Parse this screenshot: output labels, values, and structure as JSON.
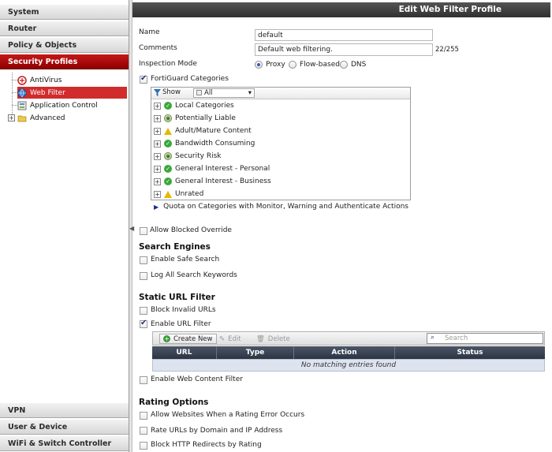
{
  "sidebar": {
    "sections_top": [
      "System",
      "Router",
      "Policy & Objects",
      "Security Profiles"
    ],
    "security_items": [
      "AntiVirus",
      "Web Filter",
      "Application Control",
      "Advanced"
    ],
    "sections_bottom": [
      "VPN",
      "User & Device",
      "WiFi & Switch Controller"
    ]
  },
  "page": {
    "title": "Edit Web Filter Profile",
    "name_label": "Name",
    "name_value": "default",
    "comments_label": "Comments",
    "comments_value": "Default web filtering.",
    "comments_count": "22/255",
    "inspection_label": "Inspection Mode",
    "inspection_options": [
      "Proxy",
      "Flow-based",
      "DNS"
    ],
    "fortiguard_label": "FortiGuard Categories"
  },
  "categories": {
    "show_label": "Show",
    "show_value": "All",
    "items": [
      {
        "label": "Local Categories",
        "status": "allow"
      },
      {
        "label": "Potentially Liable",
        "status": "monitor"
      },
      {
        "label": "Adult/Mature Content",
        "status": "warning"
      },
      {
        "label": "Bandwidth Consuming",
        "status": "allow"
      },
      {
        "label": "Security Risk",
        "status": "monitor"
      },
      {
        "label": "General Interest - Personal",
        "status": "allow"
      },
      {
        "label": "General Interest - Business",
        "status": "allow"
      },
      {
        "label": "Unrated",
        "status": "warning"
      }
    ],
    "quota_label": "Quota on Categories with Monitor, Warning and Authenticate Actions"
  },
  "options": {
    "allow_blocked_override": "Allow Blocked Override",
    "search_engines_title": "Search Engines",
    "safe_search": "Enable Safe Search",
    "log_keywords": "Log All Search Keywords",
    "static_url_title": "Static URL Filter",
    "block_invalid": "Block Invalid URLs",
    "enable_url_filter": "Enable URL Filter",
    "enable_content_filter": "Enable Web Content Filter",
    "rating_title": "Rating Options",
    "rating_error": "Allow Websites When a Rating Error Occurs",
    "rate_by_domain": "Rate URLs by Domain and IP Address",
    "block_redirects": "Block HTTP Redirects by Rating"
  },
  "url_table": {
    "create_new": "Create New",
    "edit": "Edit",
    "delete": "Delete",
    "search_placeholder": "Search",
    "columns": [
      "URL",
      "Type",
      "Action",
      "Status"
    ],
    "empty_message": "No matching entries found"
  },
  "colors": {
    "active_nav": "#b10d0d",
    "selected_item": "#d12c2c",
    "titlebar": "#3b3b3b",
    "table_header": "#353f4f"
  }
}
